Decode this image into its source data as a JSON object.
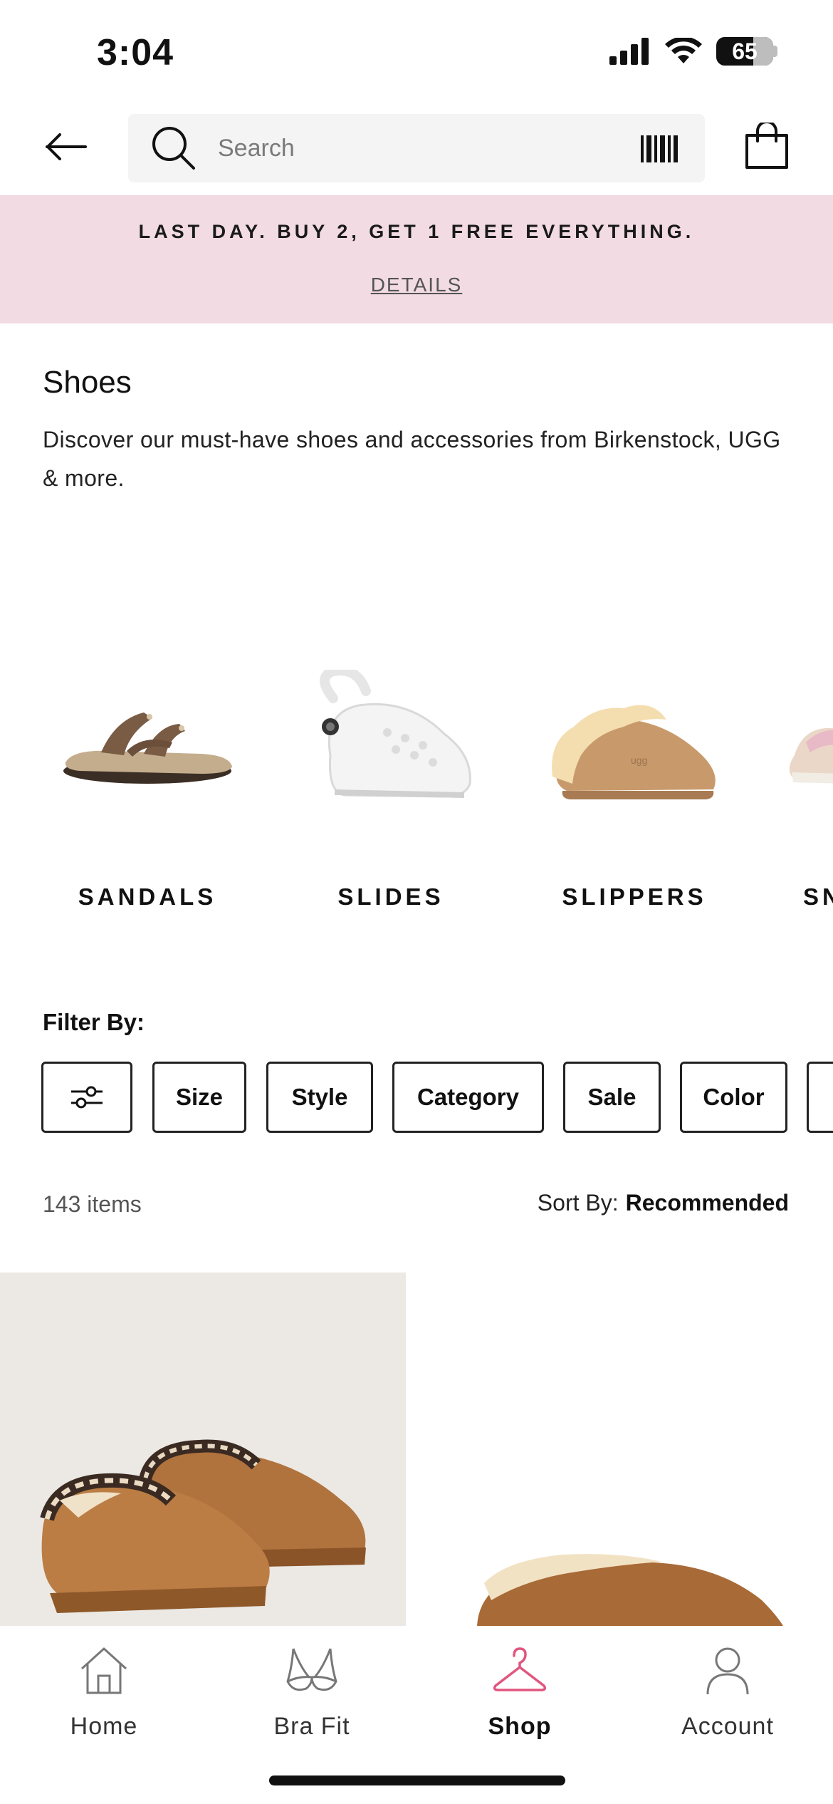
{
  "status_bar": {
    "time": "3:04",
    "battery": "65"
  },
  "search": {
    "placeholder": "Search"
  },
  "promo": {
    "title": "LAST DAY. BUY 2, GET 1 FREE EVERYTHING.",
    "details_link": "DETAILS"
  },
  "intro": {
    "title": "Shoes",
    "description": "Discover our must-have shoes and accessories from Birkenstock, UGG & more."
  },
  "categories": [
    {
      "label": "SANDALS",
      "icon": "sandal-image"
    },
    {
      "label": "SLIDES",
      "icon": "clog-image"
    },
    {
      "label": "SLIPPERS",
      "icon": "slipper-image"
    },
    {
      "label": "SN",
      "icon": "sneaker-image"
    }
  ],
  "filter": {
    "label": "Filter By:",
    "chips": [
      "Size",
      "Style",
      "Category",
      "Sale",
      "Color",
      ""
    ]
  },
  "results": {
    "count": "143 items",
    "sort_label": "Sort By:",
    "sort_value": "Recommended"
  },
  "bottom_nav": [
    {
      "label": "Home",
      "icon": "home-icon"
    },
    {
      "label": "Bra Fit",
      "icon": "bra-icon"
    },
    {
      "label": "Shop",
      "icon": "hanger-icon"
    },
    {
      "label": "Account",
      "icon": "account-icon"
    }
  ],
  "colors": {
    "promo_bg": "#f2dbe2",
    "accent_shop": "#e0567f",
    "text": "#111111"
  }
}
